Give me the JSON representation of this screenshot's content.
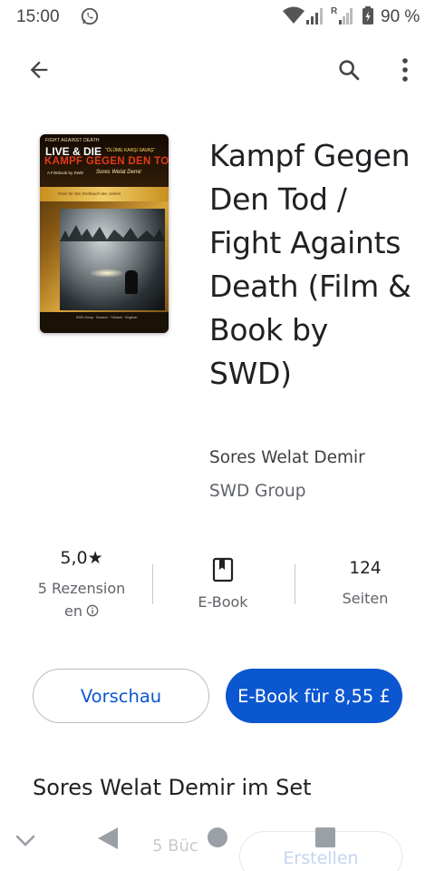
{
  "status_bar": {
    "time": "15:00",
    "network_badge": "R",
    "battery": "90 %"
  },
  "app_bar": {
    "back_icon": "arrow-left-icon",
    "search_icon": "search-icon",
    "more_icon": "more-vertical-icon"
  },
  "cover": {
    "line1": "FIGHT AGAINST DEATH",
    "line2": "LIVE & DIE",
    "line2b": "\"ÖLÜME KARŞI SAVAŞ\"",
    "title": "KAMPF GEGEN DEN TOD",
    "sub1": "A Filmbook by SWD",
    "sub2": "Sores Welat Demir",
    "band": "Preis für das Drehbuch des Jahres",
    "bottom": "SWD Group · Deutsch · Türkisch · Englisch"
  },
  "book": {
    "title": "Kampf Gegen Den Tod / Fight Againts Death (Film & Book by SWD)",
    "author": "Sores Welat Demir",
    "publisher": "SWD Group"
  },
  "stats": {
    "rating_value": "5,0",
    "rating_star": "★",
    "rating_label_line1": "5 Rezension",
    "rating_label_line2": "en",
    "format_label": "E-Book",
    "pages_value": "124",
    "pages_label": "Seiten"
  },
  "actions": {
    "preview_label": "Vorschau",
    "buy_label": "E-Book für 8,55 £"
  },
  "section": {
    "title": "Sores Welat Demir im Set",
    "count_partial": "5 Büc",
    "create_label": "Erstellen"
  },
  "colors": {
    "accent": "#0b57d0",
    "text_primary": "#202124",
    "text_secondary": "#5f6368"
  }
}
